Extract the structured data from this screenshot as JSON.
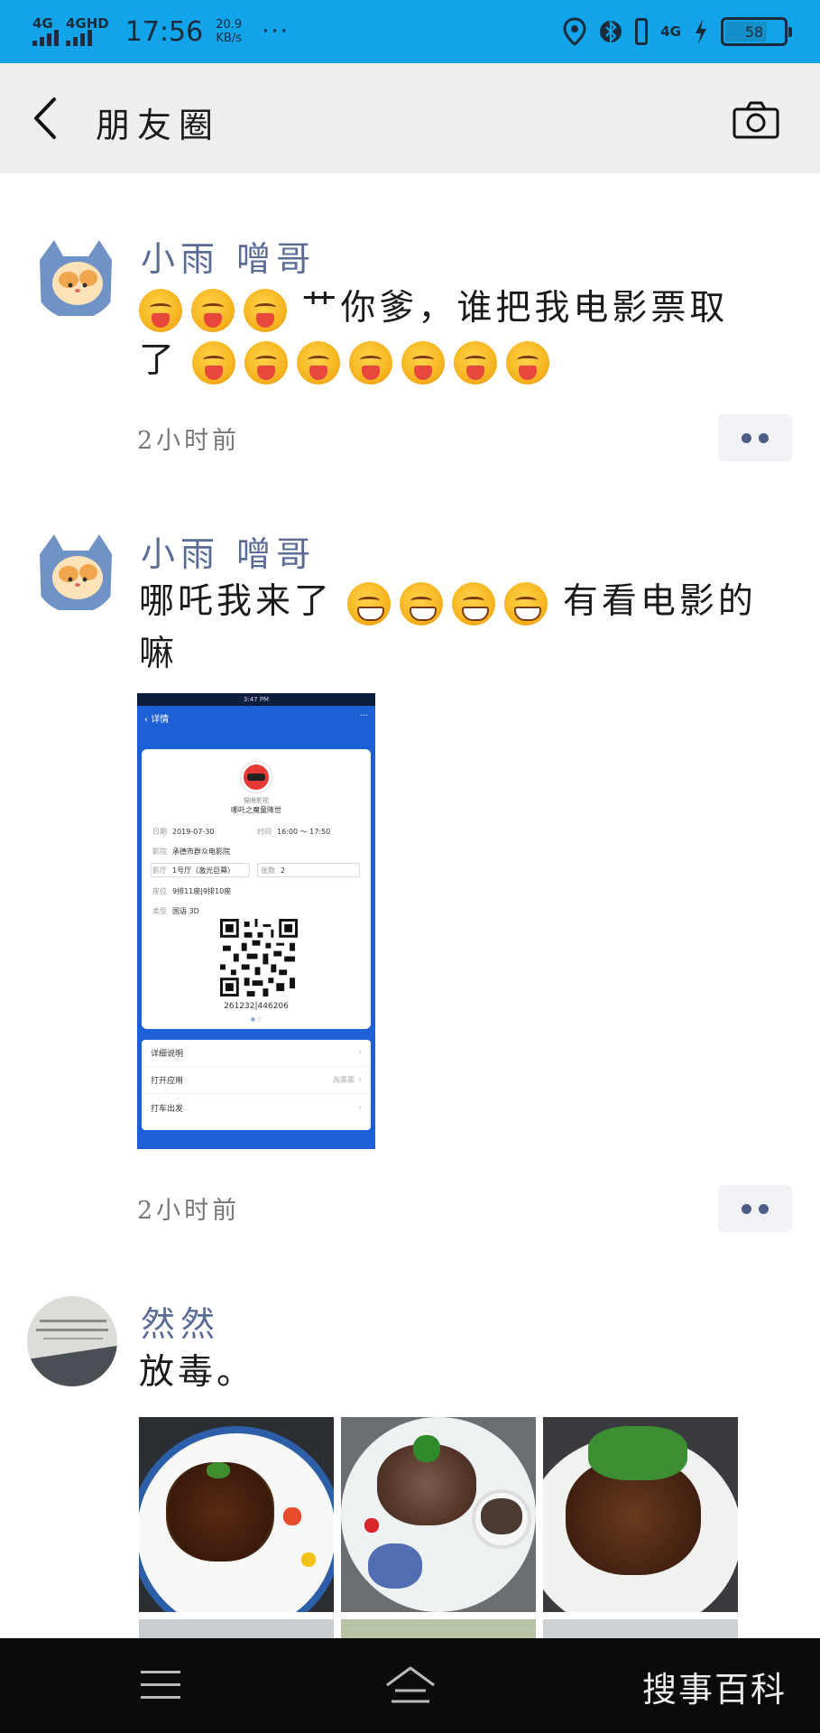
{
  "status_bar": {
    "signal1": "4G",
    "signal2": "4GHD",
    "time": "17:56",
    "speed_value": "20.9",
    "speed_unit": "KB/s",
    "more": "···",
    "network": "4G",
    "battery": "58"
  },
  "header": {
    "title": "朋友圈",
    "back_icon": "chevron-left",
    "camera_icon": "camera"
  },
  "posts": [
    {
      "author": "小雨 噌哥",
      "text_before": "",
      "text_line1": "艹你爹，谁把我电影票取",
      "text_line2": "了",
      "emoji_type": "tongue",
      "time": "2小时前"
    },
    {
      "author": "小雨 噌哥",
      "text_before": "哪吒我来了",
      "text_after": "有看电影的",
      "text_line2": "嘛",
      "emoji_type": "grin",
      "time": "2小时前",
      "ticket": {
        "status_time": "3:47 PM",
        "nav_title": "详情",
        "nav_more": "···",
        "subtitle": "猫眼影视",
        "film": "哪吒之魔童降世",
        "date_key": "日期",
        "date_value": "2019-07-30",
        "time_key": "时间",
        "time_value": "16:00 ～ 17:50",
        "cinema_key": "影院",
        "cinema_value": "承德市群众电影院",
        "hall_key": "影厅",
        "hall_value": "1号厅（激光巨幕）",
        "count_key": "张数",
        "count_value": "2",
        "seat_key": "座位",
        "seat_value": "9排11座|9排10座",
        "type_key": "类型",
        "type_value": "国语 3D",
        "code": "261232|446206",
        "list": [
          {
            "label": "详细说明",
            "hint": ""
          },
          {
            "label": "打开应用",
            "hint": "淘票票"
          },
          {
            "label": "打车出发",
            "hint": ""
          }
        ]
      }
    },
    {
      "author": "然然",
      "text": "放毒。",
      "avatar_text": "你的努力"
    }
  ],
  "bottom_nav": {
    "menu_icon": "menu",
    "home_icon": "home",
    "watermark": "搜事百科"
  },
  "colors": {
    "status_bar": "#12a4ea",
    "header": "#eeeeee",
    "author_name": "#5a6c96",
    "nav_bar": "#0b0b0b"
  }
}
